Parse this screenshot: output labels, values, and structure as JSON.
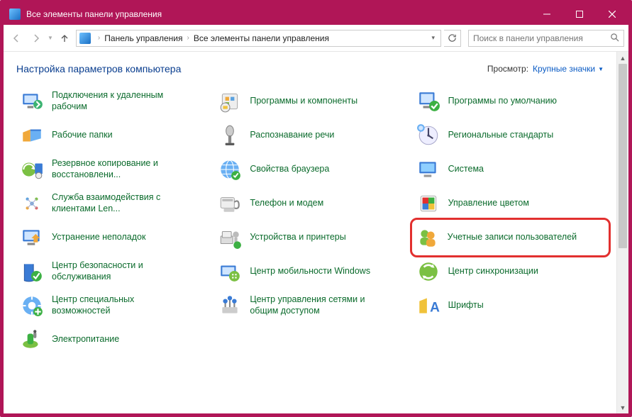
{
  "window": {
    "title": "Все элементы панели управления"
  },
  "breadcrumb": {
    "root": "Панель управления",
    "current": "Все элементы панели управления"
  },
  "search": {
    "placeholder": "Поиск в панели управления"
  },
  "header": {
    "title": "Настройка параметров компьютера"
  },
  "view": {
    "label": "Просмотр:",
    "value": "Крупные значки"
  },
  "items": [
    {
      "label": "Подключения к удаленным рабочим"
    },
    {
      "label": "Программы и компоненты"
    },
    {
      "label": "Программы по умолчанию"
    },
    {
      "label": "Рабочие папки"
    },
    {
      "label": "Распознавание речи"
    },
    {
      "label": "Региональные стандарты"
    },
    {
      "label": "Резервное копирование и восстановлени..."
    },
    {
      "label": "Свойства браузера"
    },
    {
      "label": "Система"
    },
    {
      "label": "Служба взаимодействия с клиентами Len..."
    },
    {
      "label": "Телефон и модем"
    },
    {
      "label": "Управление цветом"
    },
    {
      "label": "Устранение неполадок"
    },
    {
      "label": "Устройства и принтеры"
    },
    {
      "label": "Учетные записи пользователей"
    },
    {
      "label": "Центр безопасности и обслуживания"
    },
    {
      "label": "Центр мобильности Windows"
    },
    {
      "label": "Центр синхронизации"
    },
    {
      "label": "Центр специальных возможностей"
    },
    {
      "label": "Центр управления сетями и общим доступом"
    },
    {
      "label": "Шрифты"
    },
    {
      "label": "Электропитание"
    }
  ],
  "highlight_index": 14
}
